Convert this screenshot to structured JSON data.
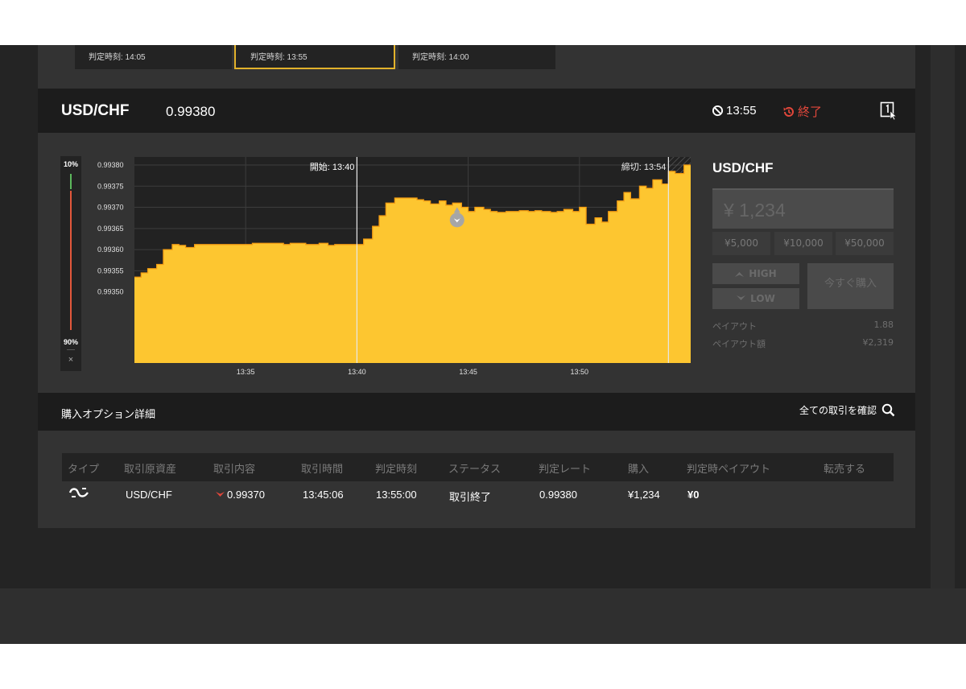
{
  "expiry_slots": [
    {
      "label": "判定時刻: 14:05",
      "selected": false
    },
    {
      "label": "判定時刻: 13:55",
      "selected": true
    },
    {
      "label": "判定時刻: 14:00",
      "selected": false
    }
  ],
  "header": {
    "pair": "USD/CHF",
    "rate": "0.99380",
    "expiry_time": "13:55",
    "status": "終了"
  },
  "gauge": {
    "top_label": "10%",
    "bottom_label": "90%",
    "close_label": "×",
    "high_share": 0.1,
    "low_share": 0.9
  },
  "chart_data": {
    "type": "area",
    "y_tick_labels": [
      "0.99380",
      "0.99375",
      "0.99370",
      "0.99365",
      "0.99360",
      "0.99355",
      "0.99350"
    ],
    "y_ticks": [
      0.9938,
      0.99375,
      0.9937,
      0.99365,
      0.9936,
      0.99355,
      0.9935
    ],
    "x_tick_labels": [
      "13:35",
      "13:40",
      "13:45",
      "13:50"
    ],
    "x_ticks": [
      35,
      40,
      45,
      50
    ],
    "xlim": [
      30,
      55
    ],
    "ylim": [
      0.993332,
      0.993819
    ],
    "start_label": "開始: 13:40",
    "start_x": 40,
    "close_label": "締切: 13:54",
    "close_x": 54,
    "entry_point": [
      44.5,
      0.99367
    ],
    "x": [
      30.0,
      30.3,
      30.6,
      31.0,
      31.3,
      31.7,
      32.0,
      32.3,
      32.7,
      33.0,
      33.3,
      33.7,
      34.0,
      34.3,
      34.7,
      35.0,
      35.3,
      35.7,
      36.0,
      36.3,
      36.7,
      37.0,
      37.3,
      37.7,
      38.0,
      38.3,
      38.7,
      39.0,
      39.3,
      39.7,
      40.0,
      40.3,
      40.7,
      41.0,
      41.3,
      41.7,
      42.0,
      42.3,
      42.7,
      43.0,
      43.3,
      43.7,
      44.0,
      44.3,
      44.7,
      45.0,
      45.3,
      45.7,
      46.0,
      46.3,
      46.7,
      47.0,
      47.3,
      47.7,
      48.0,
      48.3,
      48.7,
      49.0,
      49.3,
      49.7,
      50.0,
      50.3,
      50.7,
      51.0,
      51.3,
      51.7,
      52.0,
      52.3,
      52.7,
      53.0,
      53.3,
      53.7,
      54.0,
      54.3,
      54.7,
      55.0
    ],
    "values": [
      0.993535,
      0.993545,
      0.993555,
      0.993565,
      0.9936,
      0.993612,
      0.99361,
      0.993605,
      0.993612,
      0.993612,
      0.993612,
      0.993612,
      0.993612,
      0.993612,
      0.993612,
      0.993612,
      0.993615,
      0.993615,
      0.993615,
      0.993615,
      0.993612,
      0.993615,
      0.993615,
      0.993612,
      0.993612,
      0.993615,
      0.99361,
      0.993612,
      0.993612,
      0.993612,
      0.993612,
      0.993625,
      0.993655,
      0.99368,
      0.99371,
      0.993722,
      0.993722,
      0.993722,
      0.993718,
      0.993715,
      0.993708,
      0.993715,
      0.993705,
      0.99371,
      0.9937,
      0.99369,
      0.9937,
      0.993695,
      0.99369,
      0.993688,
      0.99369,
      0.99369,
      0.993692,
      0.99369,
      0.993692,
      0.99369,
      0.993688,
      0.99369,
      0.993695,
      0.99369,
      0.9937,
      0.99366,
      0.993675,
      0.993665,
      0.99369,
      0.993715,
      0.993735,
      0.99372,
      0.99375,
      0.993745,
      0.993765,
      0.993755,
      0.993785,
      0.99378,
      0.9938,
      0.9938
    ]
  },
  "trade_panel": {
    "pair": "USD/CHF",
    "amount_placeholder": "¥ 1,234",
    "quick_amounts": [
      "¥5,000",
      "¥10,000",
      "¥50,000"
    ],
    "high_label": "HIGH",
    "low_label": "LOW",
    "buy_now_label": "今すぐ購入",
    "payout_label": "ペイアウト",
    "payout_value": "1.88",
    "payout_amount_label": "ペイアウト額",
    "payout_amount_value": "¥2,319"
  },
  "detail": {
    "title": "購入オプション詳細",
    "view_all_label": "全ての取引を確認"
  },
  "table": {
    "columns": [
      "タイプ",
      "取引原資産",
      "取引内容",
      "取引時間",
      "判定時刻",
      "ステータス",
      "判定レート",
      "購入",
      "判定時ペイアウト",
      "転売する"
    ],
    "row": {
      "asset": "USD/CHF",
      "direction_rate": "0.99370",
      "trade_time": "13:45:06",
      "expiry_time": "13:55:00",
      "status": "取引終了",
      "expiry_rate": "0.99380",
      "purchase": "¥1,234",
      "payout": "¥0"
    }
  },
  "colors": {
    "accent": "#fdc630",
    "danger": "#e2473b",
    "high_bar": "#5cb85c",
    "low_bar": "#e2573b"
  }
}
